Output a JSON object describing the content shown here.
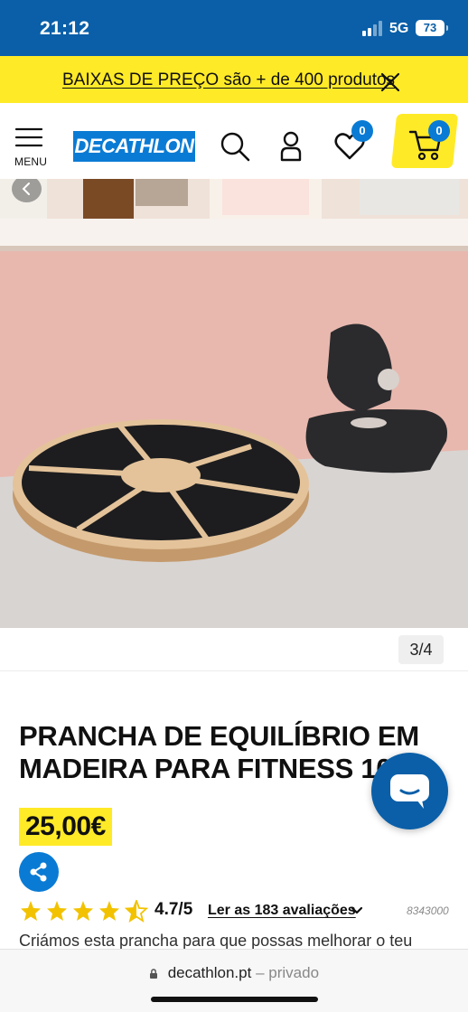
{
  "status_bar": {
    "time": "21:12",
    "network": "5G",
    "battery": "73"
  },
  "promo": {
    "text": "BAIXAS DE PREÇO são + de 400 produtos"
  },
  "header": {
    "menu_label": "MENU",
    "logo_text": "DECATHLON",
    "wishlist_count": "0",
    "cart_count": "0",
    "icons": [
      "menu-icon",
      "search-icon",
      "account-icon",
      "heart-icon",
      "cart-icon"
    ]
  },
  "gallery": {
    "counter": "3/4"
  },
  "product": {
    "title": "PRANCHA DE EQUILÍBRIO EM MADEIRA PARA FITNESS 10",
    "price": "25,00€",
    "rating_value": "4.7/5",
    "stars": 4.5,
    "reviews_link": "Ler as 183 avaliações",
    "reference": "8343000",
    "description": "Criámos esta prancha para que possas melhorar o teu"
  },
  "browser": {
    "url": "decathlon.pt",
    "separator": "–",
    "mode": "privado"
  },
  "colors": {
    "brand_blue": "#0a7bd4",
    "dark_blue": "#0a5fa8",
    "promo_yellow": "#ffea28"
  }
}
